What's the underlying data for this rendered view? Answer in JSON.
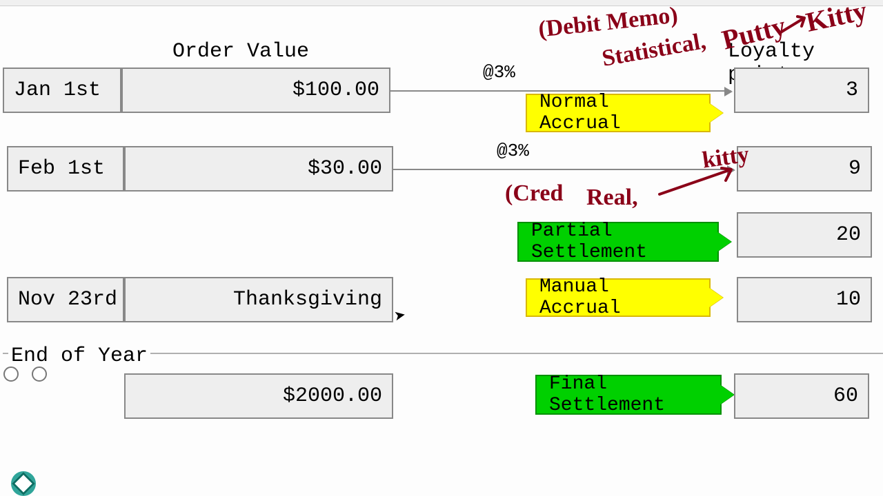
{
  "headers": {
    "order_value": "Order Value",
    "loyalty_points": "Loyalty points"
  },
  "rows": {
    "r1": {
      "date": "Jan 1st",
      "value": "$100.00",
      "rate": "@3%",
      "tag": "Normal Accrual",
      "points": "3"
    },
    "r2": {
      "date": "Feb 1st",
      "value": "$30.00",
      "rate": "@3%",
      "points": "9"
    },
    "r3": {
      "tag": "Partial Settlement",
      "points": "20"
    },
    "r4": {
      "date": "Nov 23rd",
      "value": "Thanksgiving",
      "tag": "Manual Accrual",
      "points": "10"
    },
    "eoy": {
      "label": "End of Year",
      "value": "$2000.00",
      "tag": "Final Settlement",
      "points": "60"
    }
  },
  "handwriting": {
    "debit_memo": "(Debit Memo)",
    "statistical": "Statistical,",
    "putty": "Putty",
    "kitty_top": "Kitty",
    "kitty_mid": "kitty",
    "cred": "(Cred",
    "real": "Real,"
  },
  "colors": {
    "yellow": "#ffff00",
    "green": "#00d000",
    "ink": "#8a0018",
    "cell_bg": "#eeeeee",
    "cell_border": "#888888"
  }
}
